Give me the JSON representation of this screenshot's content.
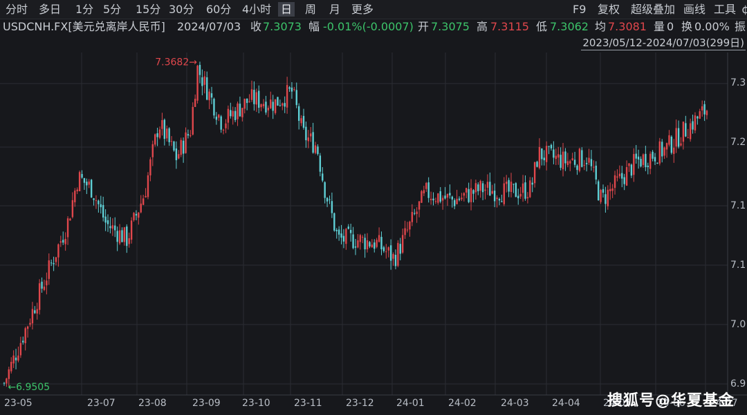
{
  "toolbar": {
    "items": [
      "分时",
      "多日",
      "1分",
      "5分",
      "15分",
      "30分",
      "60分",
      "4小时",
      "日",
      "周",
      "月",
      "更多"
    ],
    "active": "日",
    "right_items": [
      "F9",
      "复权",
      "超级叠加",
      "画线",
      "工具",
      "¢"
    ]
  },
  "info": {
    "symbol": "USDCNH.FX[美元兑离岸人民币]",
    "date": "2024/07/03",
    "close_label": "收",
    "close": "7.3073",
    "change_label": "幅",
    "change": "-0.01%(-0.0007)",
    "open_label": "开",
    "open": "7.3075",
    "high_label": "高",
    "high": "7.3115",
    "low_label": "低",
    "low": "7.3062",
    "avg_label": "均",
    "avg": "7.3081",
    "vol_label": "量",
    "vol": "0",
    "turnover_label": "换",
    "turnover": "0.00%",
    "amp_label": "振"
  },
  "range_label": "2023/05/12-2024/07/03(299日)",
  "watermark": "搜狐号@华夏基金",
  "colors": {
    "up": "#e0474c",
    "down": "#5fd0d6",
    "grid": "#2b2d33",
    "bg": "#17181c"
  },
  "chart_data": {
    "type": "candlestick",
    "title": "USDCNH.FX[美元兑离岸人民币]",
    "period": "日",
    "date_range": [
      "2023-05-12",
      "2024-07-03"
    ],
    "trading_days": 299,
    "ylim": [
      6.94,
      7.38
    ],
    "y_ticks": [
      "6.9",
      "7.0",
      "7.1",
      "7.1",
      "7.2",
      "7.3"
    ],
    "x_ticks": [
      "23-05",
      "23-07",
      "23-08",
      "23-09",
      "23-10",
      "23-11",
      "23-12",
      "24-01",
      "24-02",
      "24-03",
      "24-04",
      "24-05",
      "24-06",
      "24-07"
    ],
    "annotations": [
      {
        "text": "7.3682",
        "value": 7.3682,
        "type": "max"
      },
      {
        "text": "6.9505",
        "value": 6.9505,
        "type": "min"
      }
    ],
    "close_path": [
      {
        "t": 0,
        "close": 6.955
      },
      {
        "t": 0.05,
        "close": 7.07
      },
      {
        "t": 0.09,
        "close": 7.16
      },
      {
        "t": 0.105,
        "close": 7.22
      },
      {
        "t": 0.125,
        "close": 7.205
      },
      {
        "t": 0.145,
        "close": 7.16
      },
      {
        "t": 0.175,
        "close": 7.14
      },
      {
        "t": 0.2,
        "close": 7.2
      },
      {
        "t": 0.22,
        "close": 7.29
      },
      {
        "t": 0.245,
        "close": 7.245
      },
      {
        "t": 0.265,
        "close": 7.28
      },
      {
        "t": 0.275,
        "close": 7.36
      },
      {
        "t": 0.31,
        "close": 7.29
      },
      {
        "t": 0.35,
        "close": 7.32
      },
      {
        "t": 0.385,
        "close": 7.315
      },
      {
        "t": 0.41,
        "close": 7.33
      },
      {
        "t": 0.425,
        "close": 7.275
      },
      {
        "t": 0.445,
        "close": 7.26
      },
      {
        "t": 0.455,
        "close": 7.21
      },
      {
        "t": 0.475,
        "close": 7.14
      },
      {
        "t": 0.5,
        "close": 7.14
      },
      {
        "t": 0.53,
        "close": 7.135
      },
      {
        "t": 0.555,
        "close": 7.115
      },
      {
        "t": 0.6,
        "close": 7.2
      },
      {
        "t": 0.64,
        "close": 7.19
      },
      {
        "t": 0.68,
        "close": 7.205
      },
      {
        "t": 0.72,
        "close": 7.2
      },
      {
        "t": 0.75,
        "close": 7.205
      },
      {
        "t": 0.76,
        "close": 7.25
      },
      {
        "t": 0.8,
        "close": 7.24
      },
      {
        "t": 0.83,
        "close": 7.245
      },
      {
        "t": 0.85,
        "close": 7.19
      },
      {
        "t": 0.87,
        "close": 7.21
      },
      {
        "t": 0.9,
        "close": 7.24
      },
      {
        "t": 0.94,
        "close": 7.255
      },
      {
        "t": 1,
        "close": 7.3073
      }
    ]
  }
}
